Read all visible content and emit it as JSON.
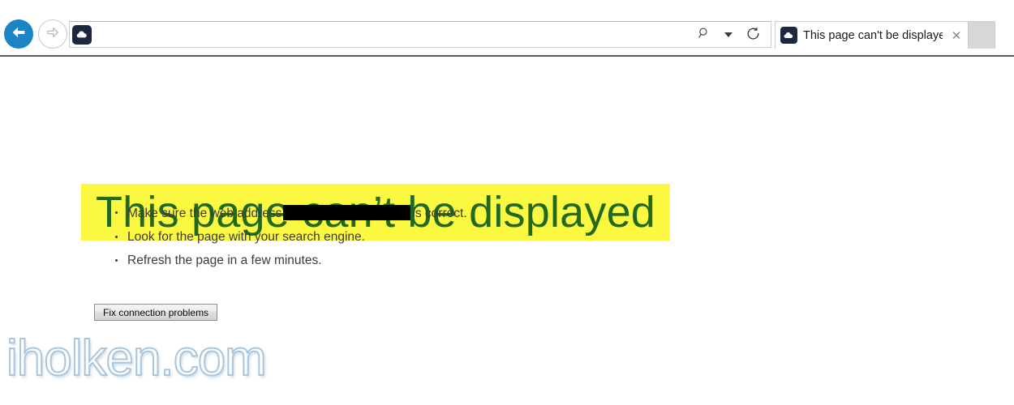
{
  "browser": {
    "nav": {
      "back_label": "Back",
      "back_icon": "arrow-left-icon",
      "back_color": "#1b84c6",
      "forward_label": "Forward",
      "forward_icon": "arrow-right-icon",
      "forward_disabled": true
    },
    "address_bar": {
      "favicon": "cloud-favicon",
      "value": "",
      "placeholder": "",
      "search_icon": "search-icon",
      "dropdown_icon": "chevron-down-icon",
      "refresh_icon": "refresh-icon",
      "refresh_label": "Refresh"
    },
    "tabs": [
      {
        "favicon": "cloud-favicon",
        "title": "This page can't be displayed",
        "close_icon": "close-icon",
        "close_label": "✕",
        "active": true
      }
    ],
    "new_tab": {
      "label": "",
      "icon": "new-tab-icon"
    }
  },
  "page": {
    "heading": "This page can’t be displayed",
    "heading_text_color": "#22691f",
    "heading_highlight_color": "#fbf841",
    "suggestions": [
      {
        "before": "Make sure the web address",
        "redacted": true,
        "after": "is correct."
      },
      {
        "before": "Look for the page with your search engine.",
        "redacted": false,
        "after": ""
      },
      {
        "before": "Refresh the page in a few minutes.",
        "redacted": false,
        "after": ""
      }
    ],
    "fix_button_label": "Fix connection problems",
    "watermark": "iholken.com"
  }
}
